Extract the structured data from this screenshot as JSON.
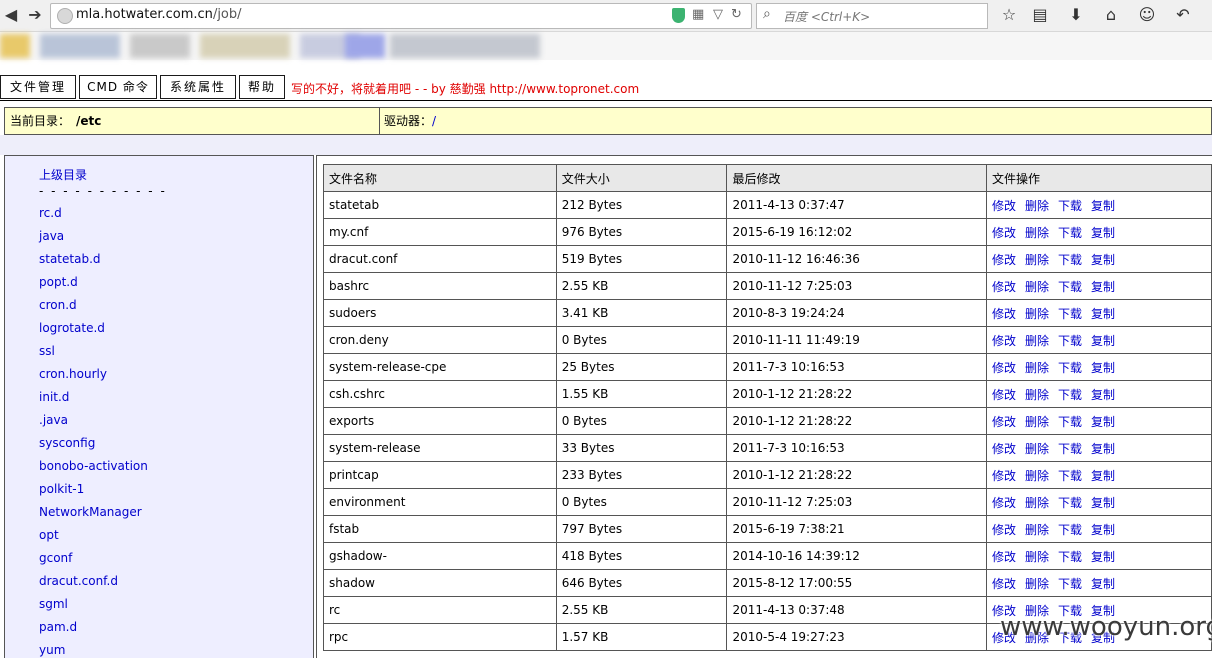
{
  "browser": {
    "url_host": "mla.hotwater.com.cn",
    "url_path": "/job/",
    "search_placeholder": "百度 <Ctrl+K>"
  },
  "menu": {
    "file_manager": "文件管理",
    "cmd": "CMD 命令",
    "sys_props": "系统属性",
    "help": "帮助",
    "slogan": "写的不好，将就着用吧 - - by 慈勤强 http://www.topronet.com"
  },
  "pathbar": {
    "current_label": "当前目录：",
    "current_value": "/etc",
    "drive_label": "驱动器：",
    "drive_value": "/"
  },
  "dirs": {
    "up": "上级目录",
    "separator": "- - - - - - - - - - -",
    "items": [
      "rc.d",
      "java",
      "statetab.d",
      "popt.d",
      "cron.d",
      "logrotate.d",
      "ssl",
      "cron.hourly",
      "init.d",
      ".java",
      "sysconfig",
      "bonobo-activation",
      "polkit-1",
      "NetworkManager",
      "opt",
      "gconf",
      "dracut.conf.d",
      "sgml",
      "pam.d",
      "yum"
    ]
  },
  "table": {
    "headers": [
      "文件名称",
      "文件大小",
      "最后修改",
      "文件操作"
    ],
    "actions": [
      "修改",
      "删除",
      "下载",
      "复制"
    ],
    "rows": [
      [
        "statetab",
        "212 Bytes",
        "2011-4-13 0:37:47"
      ],
      [
        "my.cnf",
        "976 Bytes",
        "2015-6-19 16:12:02"
      ],
      [
        "dracut.conf",
        "519 Bytes",
        "2010-11-12 16:46:36"
      ],
      [
        "bashrc",
        "2.55 KB",
        "2010-11-12 7:25:03"
      ],
      [
        "sudoers",
        "3.41 KB",
        "2010-8-3 19:24:24"
      ],
      [
        "cron.deny",
        "0 Bytes",
        "2010-11-11 11:49:19"
      ],
      [
        "system-release-cpe",
        "25 Bytes",
        "2011-7-3 10:16:53"
      ],
      [
        "csh.cshrc",
        "1.55 KB",
        "2010-1-12 21:28:22"
      ],
      [
        "exports",
        "0 Bytes",
        "2010-1-12 21:28:22"
      ],
      [
        "system-release",
        "33 Bytes",
        "2011-7-3 10:16:53"
      ],
      [
        "printcap",
        "233 Bytes",
        "2010-1-12 21:28:22"
      ],
      [
        "environment",
        "0 Bytes",
        "2010-11-12 7:25:03"
      ],
      [
        "fstab",
        "797 Bytes",
        "2015-6-19 7:38:21"
      ],
      [
        "gshadow-",
        "418 Bytes",
        "2014-10-16 14:39:12"
      ],
      [
        "shadow",
        "646 Bytes",
        "2015-8-12 17:00:55"
      ],
      [
        "rc",
        "2.55 KB",
        "2011-4-13 0:37:48"
      ],
      [
        "rpc",
        "1.57 KB",
        "2010-5-4 19:27:23"
      ]
    ]
  },
  "watermark": "www.wooyun.org"
}
